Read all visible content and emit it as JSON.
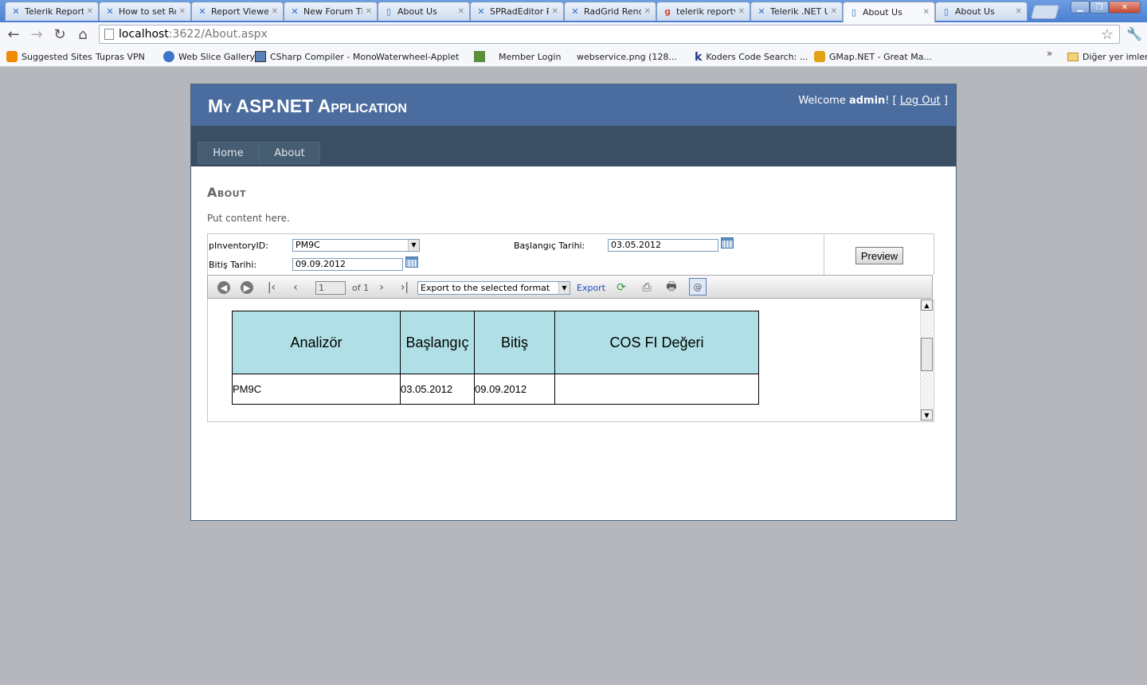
{
  "browser": {
    "tabs": [
      {
        "label": "Telerik Report",
        "icon": "telerik-icon"
      },
      {
        "label": "How to set Re",
        "icon": "telerik-icon"
      },
      {
        "label": "Report Viewer",
        "icon": "telerik-icon"
      },
      {
        "label": "New Forum Th",
        "icon": "telerik-icon"
      },
      {
        "label": "About Us",
        "icon": "page-icon"
      },
      {
        "label": "SPRadEditor R",
        "icon": "telerik-icon"
      },
      {
        "label": "RadGrid Rend",
        "icon": "telerik-icon"
      },
      {
        "label": "telerik reportv",
        "icon": "google-icon"
      },
      {
        "label": "Telerik .NET U",
        "icon": "telerik-icon"
      },
      {
        "label": "About Us",
        "icon": "page-icon"
      },
      {
        "label": "About Us",
        "icon": "page-icon"
      }
    ],
    "address": {
      "host": "localhost",
      "path": ":3622/About.aspx"
    },
    "bookmarks": [
      {
        "label": "Suggested Sites",
        "icon": "orange"
      },
      {
        "label": "Tupras VPN",
        "icon": "page"
      },
      {
        "label": "Web Slice Gallery",
        "icon": "ie"
      },
      {
        "label": "CSharp Compiler - Mono",
        "icon": "cs"
      },
      {
        "label": "Waterwheel-Applet",
        "icon": "page"
      },
      {
        "label": "",
        "icon": "green"
      },
      {
        "label": "Member Login",
        "icon": "page"
      },
      {
        "label": "webservice.png (128...",
        "icon": "page"
      },
      {
        "label": "Koders Code Search: ...",
        "icon": "k"
      },
      {
        "label": "GMap.NET - Great Ma...",
        "icon": "gmap"
      }
    ],
    "other_bookmarks": "Diğer yer imleri"
  },
  "app": {
    "title": "My ASP.NET Application",
    "welcome": "Welcome ",
    "user": "admin",
    "after_user": "! [ ",
    "logout": "Log Out",
    "close_bracket": " ]",
    "menu": [
      "Home",
      "About"
    ]
  },
  "content": {
    "title": "About",
    "intro": "Put content here."
  },
  "params": {
    "inventory_label": "pInventoryID:",
    "inventory_value": "PM9C",
    "start_label": "Başlangıç Tarihi:",
    "start_value": "03.05.2012",
    "end_label": "Bitiş Tarihi:",
    "end_value": "09.09.2012",
    "preview": "Preview"
  },
  "viewer": {
    "page_value": "1",
    "of_pages": "of 1",
    "export_format": "Export to the selected format",
    "export_link": "Export"
  },
  "report": {
    "columns": [
      "Analizör",
      "Başlangıç",
      "Bitiş",
      "COS FI Değeri"
    ],
    "rows": [
      [
        "PM9C",
        "03.05.2012",
        "09.09.2012",
        ""
      ]
    ]
  }
}
